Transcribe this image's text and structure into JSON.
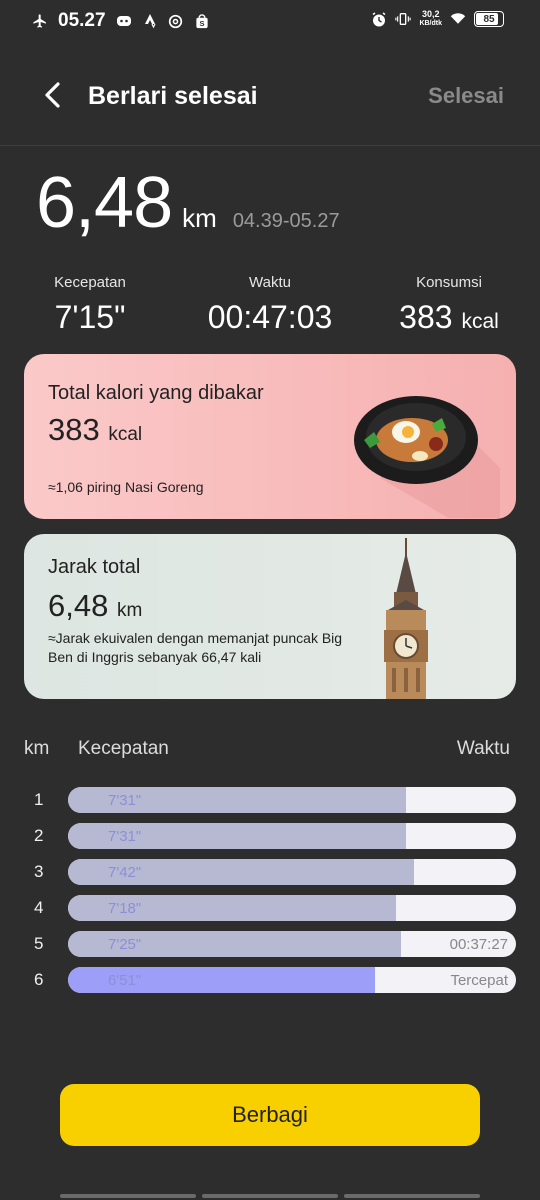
{
  "status": {
    "time": "05.27",
    "net_speed_top": "30,2",
    "net_speed_bottom": "KB/dtk",
    "battery": "85"
  },
  "header": {
    "title": "Berlari selesai",
    "done_label": "Selesai"
  },
  "summary": {
    "distance": "6,48",
    "distance_unit": "km",
    "time_range": "04.39-05.27"
  },
  "stats": {
    "pace_label": "Kecepatan",
    "pace_value": "7'15\"",
    "duration_label": "Waktu",
    "duration_value": "00:47:03",
    "calories_label": "Konsumsi",
    "calories_value": "383",
    "calories_unit": "kcal"
  },
  "calorie_card": {
    "title": "Total kalori yang dibakar",
    "value": "383",
    "unit": "kcal",
    "note": "≈1,06 piring Nasi Goreng"
  },
  "distance_card": {
    "title": "Jarak total",
    "value": "6,48",
    "unit": "km",
    "note": "≈Jarak ekuivalen dengan memanjat puncak Big Ben di Inggris sebanyak 66,47 kali"
  },
  "splits": {
    "col_km": "km",
    "col_pace": "Kecepatan",
    "col_time": "Waktu",
    "rows": [
      {
        "km": "1",
        "pace": "7'31\"",
        "fill": 0.755,
        "right": "",
        "fastest": false
      },
      {
        "km": "2",
        "pace": "7'31\"",
        "fill": 0.755,
        "right": "",
        "fastest": false
      },
      {
        "km": "3",
        "pace": "7'42\"",
        "fill": 0.772,
        "right": "",
        "fastest": false
      },
      {
        "km": "4",
        "pace": "7'18\"",
        "fill": 0.733,
        "right": "",
        "fastest": false
      },
      {
        "km": "5",
        "pace": "7'25\"",
        "fill": 0.743,
        "right": "00:37:27",
        "fastest": false
      },
      {
        "km": "6",
        "pace": "6'51\"",
        "fill": 0.686,
        "right": "Tercepat",
        "fastest": true
      }
    ]
  },
  "share_label": "Berbagi",
  "colors": {
    "accent": "#f8d000",
    "bar": "#b7b8d2",
    "bar_fastest": "#9c9ef8"
  }
}
